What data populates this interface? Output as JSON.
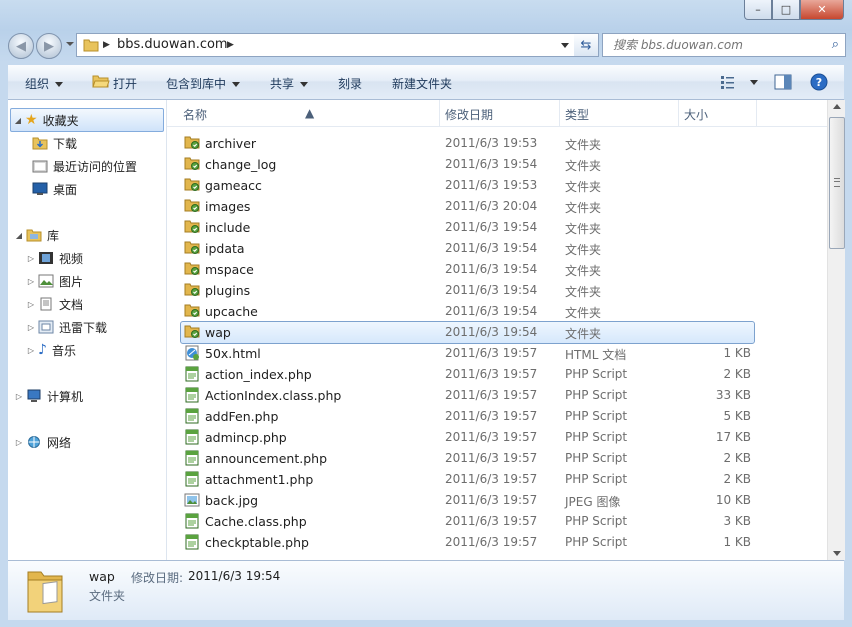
{
  "window": {
    "minimize_label": "–",
    "maximize_label": "□",
    "close_label": "✕"
  },
  "address": {
    "path": "bbs.duowan.com",
    "search_placeholder": "搜索 bbs.duowan.com"
  },
  "toolbar": {
    "organize": "组织",
    "open": "打开",
    "include_in_library": "包含到库中",
    "share": "共享",
    "burn": "刻录",
    "new_folder": "新建文件夹"
  },
  "nav": {
    "favorites": "收藏夹",
    "downloads": "下载",
    "recent": "最近访问的位置",
    "desktop": "桌面",
    "libraries": "库",
    "videos": "视频",
    "pictures": "图片",
    "documents": "文档",
    "thunder": "迅雷下载",
    "music": "音乐",
    "computer": "计算机",
    "network": "网络"
  },
  "columns": {
    "name": "名称",
    "date": "修改日期",
    "type": "类型",
    "size": "大小"
  },
  "files": [
    {
      "name": "archiver",
      "date": "2011/6/3 19:53",
      "type": "文件夹",
      "size": "",
      "icon": "folder-icon"
    },
    {
      "name": "change_log",
      "date": "2011/6/3 19:54",
      "type": "文件夹",
      "size": "",
      "icon": "folder-icon"
    },
    {
      "name": "gameacc",
      "date": "2011/6/3 19:53",
      "type": "文件夹",
      "size": "",
      "icon": "folder-icon"
    },
    {
      "name": "images",
      "date": "2011/6/3 20:04",
      "type": "文件夹",
      "size": "",
      "icon": "folder-icon"
    },
    {
      "name": "include",
      "date": "2011/6/3 19:54",
      "type": "文件夹",
      "size": "",
      "icon": "folder-icon"
    },
    {
      "name": "ipdata",
      "date": "2011/6/3 19:54",
      "type": "文件夹",
      "size": "",
      "icon": "folder-icon"
    },
    {
      "name": "mspace",
      "date": "2011/6/3 19:54",
      "type": "文件夹",
      "size": "",
      "icon": "folder-icon"
    },
    {
      "name": "plugins",
      "date": "2011/6/3 19:54",
      "type": "文件夹",
      "size": "",
      "icon": "folder-icon"
    },
    {
      "name": "upcache",
      "date": "2011/6/3 19:54",
      "type": "文件夹",
      "size": "",
      "icon": "folder-icon"
    },
    {
      "name": "wap",
      "date": "2011/6/3 19:54",
      "type": "文件夹",
      "size": "",
      "icon": "folder-icon"
    },
    {
      "name": "50x.html",
      "date": "2011/6/3 19:57",
      "type": "HTML 文档",
      "size": "1 KB",
      "icon": "html-file-icon"
    },
    {
      "name": "action_index.php",
      "date": "2011/6/3 19:57",
      "type": "PHP Script",
      "size": "2 KB",
      "icon": "php-file-icon"
    },
    {
      "name": "ActionIndex.class.php",
      "date": "2011/6/3 19:57",
      "type": "PHP Script",
      "size": "33 KB",
      "icon": "php-file-icon"
    },
    {
      "name": "addFen.php",
      "date": "2011/6/3 19:57",
      "type": "PHP Script",
      "size": "5 KB",
      "icon": "php-file-icon"
    },
    {
      "name": "admincp.php",
      "date": "2011/6/3 19:57",
      "type": "PHP Script",
      "size": "17 KB",
      "icon": "php-file-icon"
    },
    {
      "name": "announcement.php",
      "date": "2011/6/3 19:57",
      "type": "PHP Script",
      "size": "2 KB",
      "icon": "php-file-icon"
    },
    {
      "name": "attachment1.php",
      "date": "2011/6/3 19:57",
      "type": "PHP Script",
      "size": "2 KB",
      "icon": "php-file-icon"
    },
    {
      "name": "back.jpg",
      "date": "2011/6/3 19:57",
      "type": "JPEG 图像",
      "size": "10 KB",
      "icon": "jpeg-file-icon"
    },
    {
      "name": "Cache.class.php",
      "date": "2011/6/3 19:57",
      "type": "PHP Script",
      "size": "3 KB",
      "icon": "php-file-icon"
    },
    {
      "name": "checkptable.php",
      "date": "2011/6/3 19:57",
      "type": "PHP Script",
      "size": "1 KB",
      "icon": "php-file-icon"
    }
  ],
  "selected_index": 9,
  "details": {
    "name": "wap",
    "modified_label": "修改日期:",
    "modified_value": "2011/6/3 19:54",
    "type": "文件夹"
  },
  "colors": {
    "selection": "#cfe3fa",
    "selection_border": "#7da2ce",
    "link_text": "#1e395b"
  }
}
